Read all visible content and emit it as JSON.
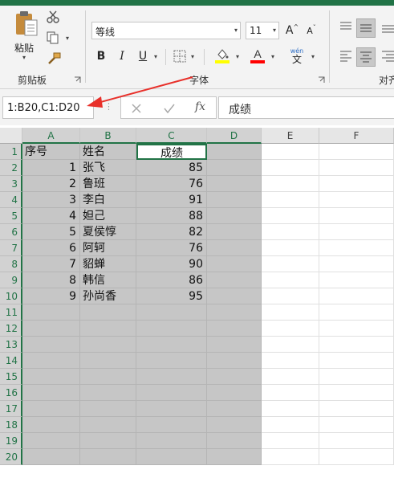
{
  "ribbon": {
    "clipboard": {
      "paste_label": "粘贴",
      "group_label": "剪贴板"
    },
    "font": {
      "font_name": "等线",
      "font_size": "11",
      "grow_label": "A",
      "shrink_label": "A",
      "bold_label": "B",
      "italic_label": "I",
      "underline_label": "U",
      "phonetic_top": "wén",
      "phonetic_bottom": "文",
      "group_label": "字体",
      "fill_color": "#ffff00",
      "font_color": "#ff0000"
    },
    "alignment": {
      "group_label_partial": "对齐"
    }
  },
  "formula_bar": {
    "name_box": "1:B20,C1:D20",
    "fx_label": "fx",
    "content": "成绩"
  },
  "sheet": {
    "columns": [
      "A",
      "B",
      "C",
      "D",
      "E",
      "F"
    ],
    "rows": [
      "1",
      "2",
      "3",
      "4",
      "5",
      "6",
      "7",
      "8",
      "9",
      "10",
      "11",
      "12",
      "13",
      "14",
      "15",
      "16",
      "17",
      "18",
      "19",
      "20"
    ],
    "header": [
      "序号",
      "姓名",
      "成绩"
    ],
    "data": [
      [
        "1",
        "张飞",
        "85"
      ],
      [
        "2",
        "鲁班",
        "76"
      ],
      [
        "3",
        "李白",
        "91"
      ],
      [
        "4",
        "妲己",
        "88"
      ],
      [
        "5",
        "夏侯惇",
        "82"
      ],
      [
        "6",
        "阿轲",
        "76"
      ],
      [
        "7",
        "貂蝉",
        "90"
      ],
      [
        "8",
        "韩信",
        "86"
      ],
      [
        "9",
        "孙尚香",
        "95"
      ]
    ]
  },
  "annotation": {
    "arrow_color": "#e8302a"
  },
  "accent": "#217346"
}
